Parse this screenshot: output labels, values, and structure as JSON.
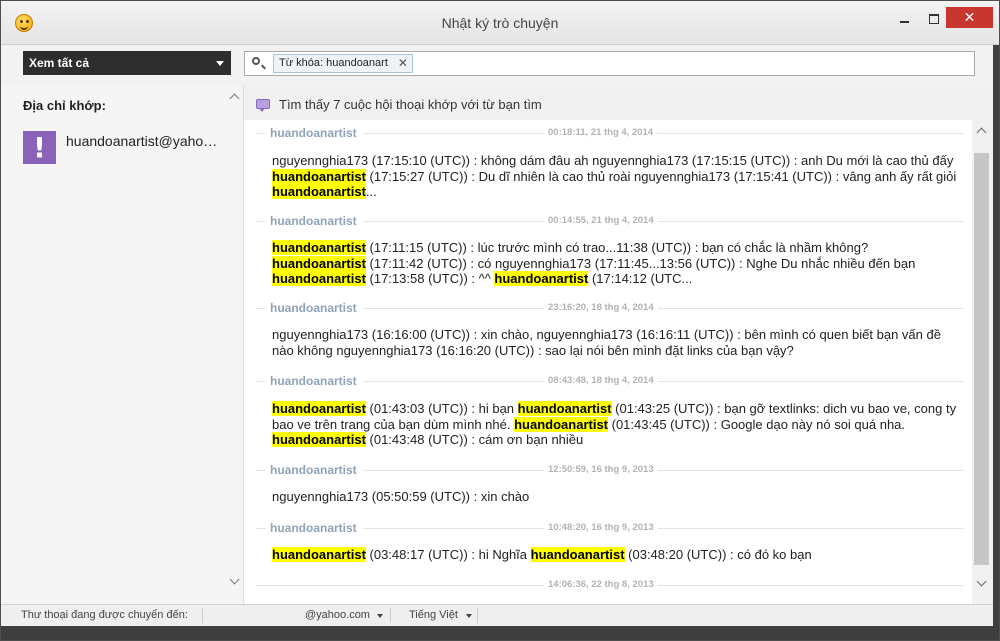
{
  "window": {
    "title": "Nhật ký trò chuyện"
  },
  "toolbar": {
    "filter_label": "Xem tất cả",
    "search_chip": "Từ khóa: huandoanart"
  },
  "sidebar": {
    "title": "Địa chỉ khớp:",
    "contact": {
      "name": "huandoanartist@yaho…",
      "avatar_glyph": "!",
      "avatar_color": "#8a63b8"
    }
  },
  "results": {
    "summary": "Tìm thấy 7 cuộc hội thoại khớp với từ bạn tìm"
  },
  "highlight_color": "#ffff00",
  "conversations": [
    {
      "name": "huandoanartist",
      "date": "00:18:11, 21 thg 4, 2014",
      "segments": [
        {
          "t": "nguyennghia173 (17:15:10 (UTC)) : không dám đâu ah nguyennghia173 (17:15:15 (UTC)) : anh Du mới là cao thủ đấy "
        },
        {
          "t": "huandoanartist",
          "hl": true
        },
        {
          "t": " (17:15:27 (UTC)) : Du dĩ nhiên là cao thủ roài nguyennghia173 (17:15:41 (UTC)) : vâng anh ấy rất giỏi "
        },
        {
          "t": "huandoanartist",
          "hl": true
        },
        {
          "t": "..."
        }
      ]
    },
    {
      "name": "huandoanartist",
      "date": "00:14:55, 21 thg 4, 2014",
      "segments": [
        {
          "t": "huandoanartist",
          "hl": true
        },
        {
          "t": " (17:11:15 (UTC)) : lúc trước mình có trao...11:38 (UTC)) : bạn có chắc là nhầm không? "
        },
        {
          "t": "huandoanartist",
          "hl": true
        },
        {
          "t": " (17:11:42 (UTC)) : có nguyennghia173 (17:11:45...13:56 (UTC)) : Nghe Du nhắc nhiều đến bạn "
        },
        {
          "t": "huandoanartist",
          "hl": true
        },
        {
          "t": " (17:13:58 (UTC)) : ^^ "
        },
        {
          "t": "huandoanartist",
          "hl": true
        },
        {
          "t": " (17:14:12 (UTC..."
        }
      ]
    },
    {
      "name": "huandoanartist",
      "date": "23:16:20, 18 thg 4, 2014",
      "segments": [
        {
          "t": "nguyennghia173 (16:16:00 (UTC)) : xin chào, nguyennghia173 (16:16:11 (UTC)) : bên mình có quen biết bạn vấn đề nào không nguyennghia173 (16:16:20 (UTC)) : sao lại nói bên mình đặt links của bạn vậy?"
        }
      ]
    },
    {
      "name": "huandoanartist",
      "date": "08:43:48, 18 thg 4, 2014",
      "segments": [
        {
          "t": "huandoanartist",
          "hl": true
        },
        {
          "t": " (01:43:03 (UTC)) : hi bạn "
        },
        {
          "t": "huandoanartist",
          "hl": true
        },
        {
          "t": " (01:43:25 (UTC)) : bạn gỡ textlinks: dich vu bao ve, cong ty bao ve trên trang của bạn dùm mình nhé. "
        },
        {
          "t": "huandoanartist",
          "hl": true
        },
        {
          "t": " (01:43:45 (UTC)) : Google dạo này nó soi quá nha. "
        },
        {
          "t": "huandoanartist",
          "hl": true
        },
        {
          "t": " (01:43:48 (UTC)) : cám ơn bạn nhiều"
        }
      ]
    },
    {
      "name": "huandoanartist",
      "date": "12:50:59, 16 thg 9, 2013",
      "segments": [
        {
          "t": "nguyennghia173 (05:50:59 (UTC)) : xin chào"
        }
      ]
    },
    {
      "name": "huandoanartist",
      "date": "10:48:20, 16 thg 9, 2013",
      "segments": [
        {
          "t": "huandoanartist",
          "hl": true
        },
        {
          "t": " (03:48:17 (UTC)) : hi Nghĩa "
        },
        {
          "t": "huandoanartist",
          "hl": true
        },
        {
          "t": " (03:48:20 (UTC)) : có đó ko bạn"
        }
      ]
    },
    {
      "name": "",
      "date": "14:06:36, 22 thg 8, 2013",
      "segments": []
    }
  ],
  "status": {
    "label": "Thư thoại đang được chuyển đến:",
    "email": "@yahoo.com",
    "language": "Tiếng Việt"
  }
}
